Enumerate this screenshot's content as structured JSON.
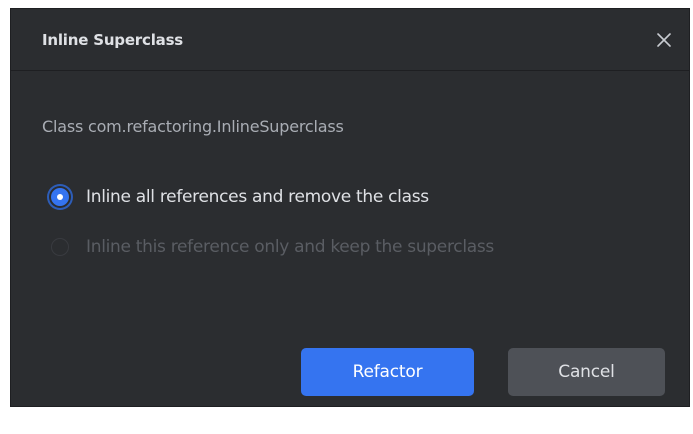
{
  "dialog": {
    "title": "Inline Superclass",
    "close_icon": "close-icon",
    "subtitle": "Class com.refactoring.InlineSuperclass",
    "options": [
      {
        "label": "Inline all references and remove the class",
        "checked": true,
        "enabled": true
      },
      {
        "label": "Inline this reference only and keep the superclass",
        "checked": false,
        "enabled": false
      }
    ],
    "buttons": {
      "primary_label": "Refactor",
      "secondary_label": "Cancel"
    },
    "colors": {
      "background": "#2b2d30",
      "accent": "#3574f0",
      "text": "#dfe1e5",
      "muted_text": "#a9adb4",
      "disabled_text": "#5a5d63",
      "secondary_button": "#4e5157"
    }
  }
}
